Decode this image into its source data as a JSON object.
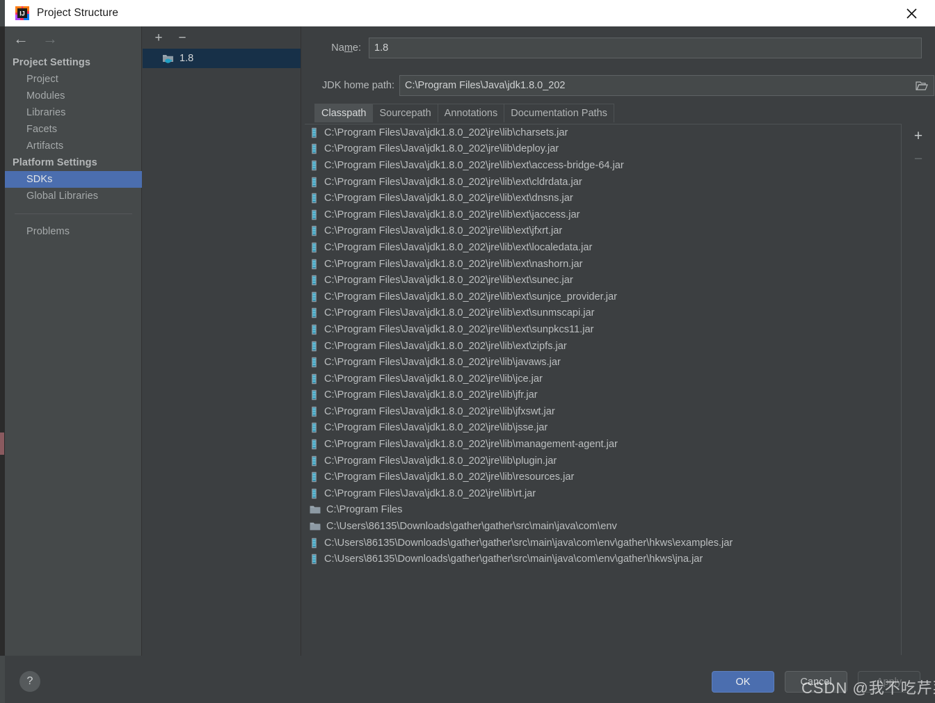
{
  "window": {
    "title": "Project Structure",
    "logo_icon": "intellij-idea-logo-icon",
    "close_icon": "close-icon"
  },
  "sidebar": {
    "back_icon": "arrow-left-icon",
    "forward_icon": "arrow-right-icon",
    "groups": [
      {
        "header": "Project Settings",
        "items": [
          {
            "label": "Project",
            "selected": false
          },
          {
            "label": "Modules",
            "selected": false
          },
          {
            "label": "Libraries",
            "selected": false
          },
          {
            "label": "Facets",
            "selected": false
          },
          {
            "label": "Artifacts",
            "selected": false
          }
        ]
      },
      {
        "header": "Platform Settings",
        "items": [
          {
            "label": "SDKs",
            "selected": true
          },
          {
            "label": "Global Libraries",
            "selected": false
          }
        ]
      }
    ],
    "problems_label": "Problems"
  },
  "sdk_panel": {
    "add_icon": "plus-icon",
    "remove_icon": "minus-icon",
    "items": [
      {
        "label": "1.8",
        "icon": "jdk-folder-icon",
        "selected": true
      }
    ]
  },
  "detail": {
    "name_label": "Name:",
    "name_label_pre": "Na",
    "name_label_mnemonic": "m",
    "name_label_post": "e:",
    "name_value": "1.8",
    "jdk_home_label": "JDK home path:",
    "jdk_home_value": "C:\\Program Files\\Java\\jdk1.8.0_202",
    "browse_icon": "folder-open-icon",
    "tabs": [
      {
        "label": "Classpath",
        "active": true
      },
      {
        "label": "Sourcepath",
        "active": false
      },
      {
        "label": "Annotations",
        "active": false
      },
      {
        "label": "Documentation Paths",
        "active": false
      }
    ],
    "list_add_icon": "plus-icon",
    "list_remove_icon": "minus-icon",
    "classpath": [
      {
        "icon": "jar-icon",
        "path": "C:\\Program Files\\Java\\jdk1.8.0_202\\jre\\lib\\charsets.jar"
      },
      {
        "icon": "jar-icon",
        "path": "C:\\Program Files\\Java\\jdk1.8.0_202\\jre\\lib\\deploy.jar"
      },
      {
        "icon": "jar-icon",
        "path": "C:\\Program Files\\Java\\jdk1.8.0_202\\jre\\lib\\ext\\access-bridge-64.jar"
      },
      {
        "icon": "jar-icon",
        "path": "C:\\Program Files\\Java\\jdk1.8.0_202\\jre\\lib\\ext\\cldrdata.jar"
      },
      {
        "icon": "jar-icon",
        "path": "C:\\Program Files\\Java\\jdk1.8.0_202\\jre\\lib\\ext\\dnsns.jar"
      },
      {
        "icon": "jar-icon",
        "path": "C:\\Program Files\\Java\\jdk1.8.0_202\\jre\\lib\\ext\\jaccess.jar"
      },
      {
        "icon": "jar-icon",
        "path": "C:\\Program Files\\Java\\jdk1.8.0_202\\jre\\lib\\ext\\jfxrt.jar"
      },
      {
        "icon": "jar-icon",
        "path": "C:\\Program Files\\Java\\jdk1.8.0_202\\jre\\lib\\ext\\localedata.jar"
      },
      {
        "icon": "jar-icon",
        "path": "C:\\Program Files\\Java\\jdk1.8.0_202\\jre\\lib\\ext\\nashorn.jar"
      },
      {
        "icon": "jar-icon",
        "path": "C:\\Program Files\\Java\\jdk1.8.0_202\\jre\\lib\\ext\\sunec.jar"
      },
      {
        "icon": "jar-icon",
        "path": "C:\\Program Files\\Java\\jdk1.8.0_202\\jre\\lib\\ext\\sunjce_provider.jar"
      },
      {
        "icon": "jar-icon",
        "path": "C:\\Program Files\\Java\\jdk1.8.0_202\\jre\\lib\\ext\\sunmscapi.jar"
      },
      {
        "icon": "jar-icon",
        "path": "C:\\Program Files\\Java\\jdk1.8.0_202\\jre\\lib\\ext\\sunpkcs11.jar"
      },
      {
        "icon": "jar-icon",
        "path": "C:\\Program Files\\Java\\jdk1.8.0_202\\jre\\lib\\ext\\zipfs.jar"
      },
      {
        "icon": "jar-icon",
        "path": "C:\\Program Files\\Java\\jdk1.8.0_202\\jre\\lib\\javaws.jar"
      },
      {
        "icon": "jar-icon",
        "path": "C:\\Program Files\\Java\\jdk1.8.0_202\\jre\\lib\\jce.jar"
      },
      {
        "icon": "jar-icon",
        "path": "C:\\Program Files\\Java\\jdk1.8.0_202\\jre\\lib\\jfr.jar"
      },
      {
        "icon": "jar-icon",
        "path": "C:\\Program Files\\Java\\jdk1.8.0_202\\jre\\lib\\jfxswt.jar"
      },
      {
        "icon": "jar-icon",
        "path": "C:\\Program Files\\Java\\jdk1.8.0_202\\jre\\lib\\jsse.jar"
      },
      {
        "icon": "jar-icon",
        "path": "C:\\Program Files\\Java\\jdk1.8.0_202\\jre\\lib\\management-agent.jar"
      },
      {
        "icon": "jar-icon",
        "path": "C:\\Program Files\\Java\\jdk1.8.0_202\\jre\\lib\\plugin.jar"
      },
      {
        "icon": "jar-icon",
        "path": "C:\\Program Files\\Java\\jdk1.8.0_202\\jre\\lib\\resources.jar"
      },
      {
        "icon": "jar-icon",
        "path": "C:\\Program Files\\Java\\jdk1.8.0_202\\jre\\lib\\rt.jar"
      },
      {
        "icon": "folder-icon",
        "path": "C:\\Program Files"
      },
      {
        "icon": "folder-icon",
        "path": "C:\\Users\\86135\\Downloads\\gather\\gather\\src\\main\\java\\com\\env"
      },
      {
        "icon": "jar-icon",
        "path": "C:\\Users\\86135\\Downloads\\gather\\gather\\src\\main\\java\\com\\env\\gather\\hkws\\examples.jar"
      },
      {
        "icon": "jar-icon",
        "path": "C:\\Users\\86135\\Downloads\\gather\\gather\\src\\main\\java\\com\\env\\gather\\hkws\\jna.jar"
      }
    ]
  },
  "footer": {
    "help_label": "?",
    "ok_label": "OK",
    "cancel_label": "Cancel",
    "apply_label": "Apply"
  },
  "watermark": "CSDN @我不吃芹菜",
  "colors": {
    "accent_blue": "#4b6eaf",
    "selected_sdk_row": "#173048",
    "dialog_bg": "#3c3f41",
    "sidebar_bg": "#45494a",
    "titlebar_bg": "#ffffff"
  }
}
